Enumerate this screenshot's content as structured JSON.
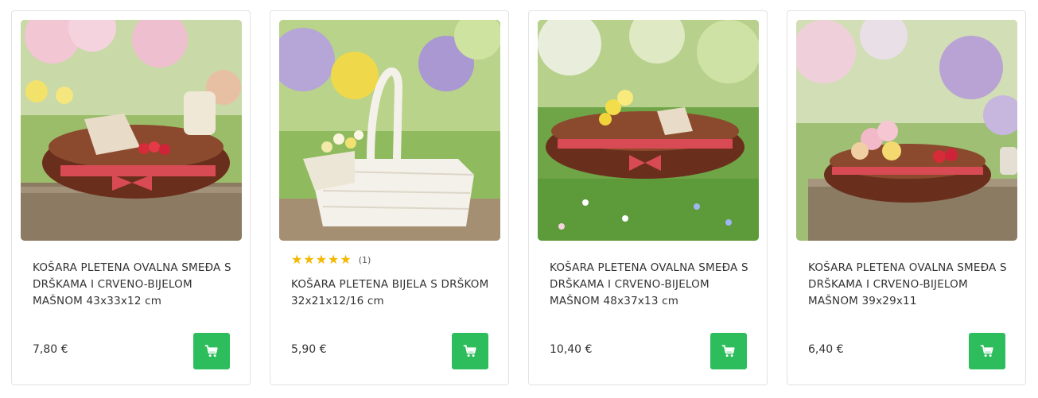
{
  "products": [
    {
      "title": "KOŠARA PLETENA OVALNA SMEĐA S DRŠKAMA I CRVENO-BIJELOM MAŠNOM 43x33x12 cm",
      "price": "7,80 €",
      "cart_icon": "shopping-cart-icon"
    },
    {
      "title": "KOŠARA PLETENA BIJELA S DRŠKOM 32x21x12/16 cm",
      "price": "5,90 €",
      "rating": {
        "stars": "★★★★★",
        "count": "(1)",
        "value": 5,
        "max": 5
      },
      "cart_icon": "shopping-cart-icon"
    },
    {
      "title": "KOŠARA PLETENA OVALNA SMEĐA S DRŠKAMA I CRVENO-BIJELOM MAŠNOM 48x37x13 cm",
      "price": "10,40 €",
      "cart_icon": "shopping-cart-icon"
    },
    {
      "title": "KOŠARA PLETENA OVALNA SMEĐA S DRŠKAMA I CRVENO-BIJELOM MAŠNOM 39x29x11",
      "price": "6,40 €",
      "cart_icon": "shopping-cart-icon"
    }
  ],
  "colors": {
    "cart_button": "#2dbd5c",
    "star": "#f5b800",
    "card_border": "#e2e2e2",
    "text": "#333333"
  }
}
